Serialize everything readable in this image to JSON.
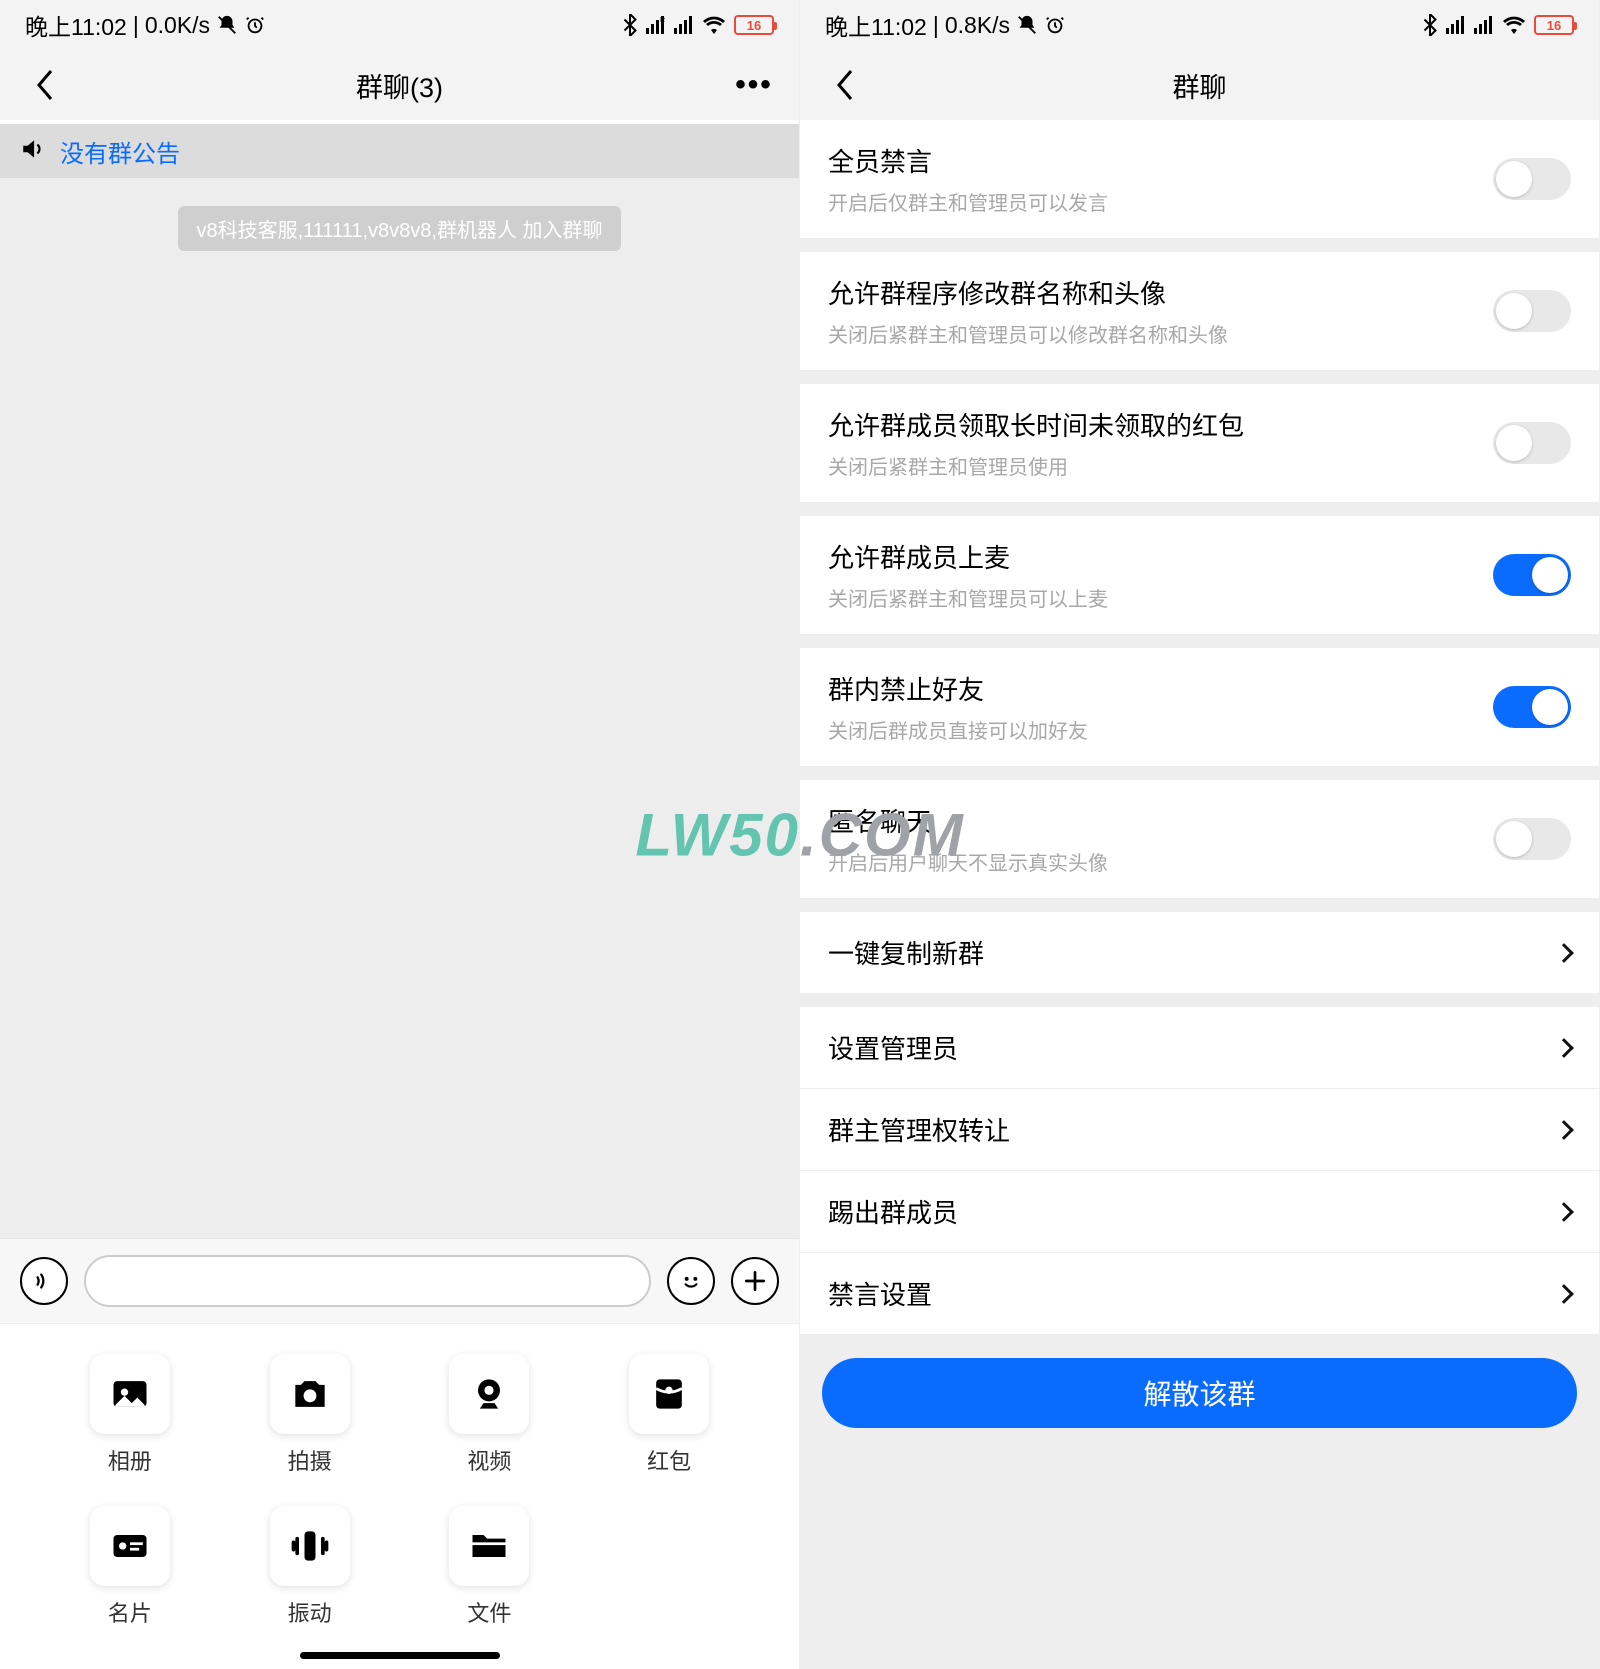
{
  "watermark": {
    "part1": "LW50",
    "part2": ".COM"
  },
  "left": {
    "status": {
      "time": "晚上11:02",
      "net": "0.0K/s",
      "battery": "16"
    },
    "nav": {
      "title": "群聊(3)",
      "more": "•••"
    },
    "announcement_label": "没有群公告",
    "system_message": "v8科技客服,111111,v8v8v8,群机器人 加入群聊",
    "attachments": [
      {
        "name": "album",
        "label": "相册"
      },
      {
        "name": "shoot",
        "label": "拍摄"
      },
      {
        "name": "video",
        "label": "视频"
      },
      {
        "name": "hongbao",
        "label": "红包"
      },
      {
        "name": "card",
        "label": "名片"
      },
      {
        "name": "vibrate",
        "label": "振动"
      },
      {
        "name": "file",
        "label": "文件"
      }
    ]
  },
  "right": {
    "status": {
      "time": "晚上11:02",
      "net": "0.8K/s",
      "battery": "16"
    },
    "nav": {
      "title": "群聊"
    },
    "toggles": [
      {
        "name": "mute-all",
        "title": "全员禁言",
        "desc": "开启后仅群主和管理员可以发言",
        "on": false
      },
      {
        "name": "allow-edit-name",
        "title": "允许群程序修改群名称和头像",
        "desc": "关闭后紧群主和管理员可以修改群名称和头像",
        "on": false
      },
      {
        "name": "allow-claim-hongbao",
        "title": "允许群成员领取长时间未领取的红包",
        "desc": "关闭后紧群主和管理员使用",
        "on": false
      },
      {
        "name": "allow-mic",
        "title": "允许群成员上麦",
        "desc": "关闭后紧群主和管理员可以上麦",
        "on": true
      },
      {
        "name": "forbid-friend",
        "title": "群内禁止好友",
        "desc": "关闭后群成员直接可以加好友",
        "on": true
      },
      {
        "name": "anonymous-chat",
        "title": "匿名聊天",
        "desc": "开启后用户聊天不显示真实头像",
        "on": false
      }
    ],
    "links": [
      {
        "name": "copy-group",
        "title": "一键复制新群",
        "gap_after": true
      },
      {
        "name": "set-admin",
        "title": "设置管理员"
      },
      {
        "name": "transfer-owner",
        "title": "群主管理权转让"
      },
      {
        "name": "kick-member",
        "title": "踢出群成员"
      },
      {
        "name": "mute-settings",
        "title": "禁言设置"
      }
    ],
    "disband_label": "解散该群"
  }
}
